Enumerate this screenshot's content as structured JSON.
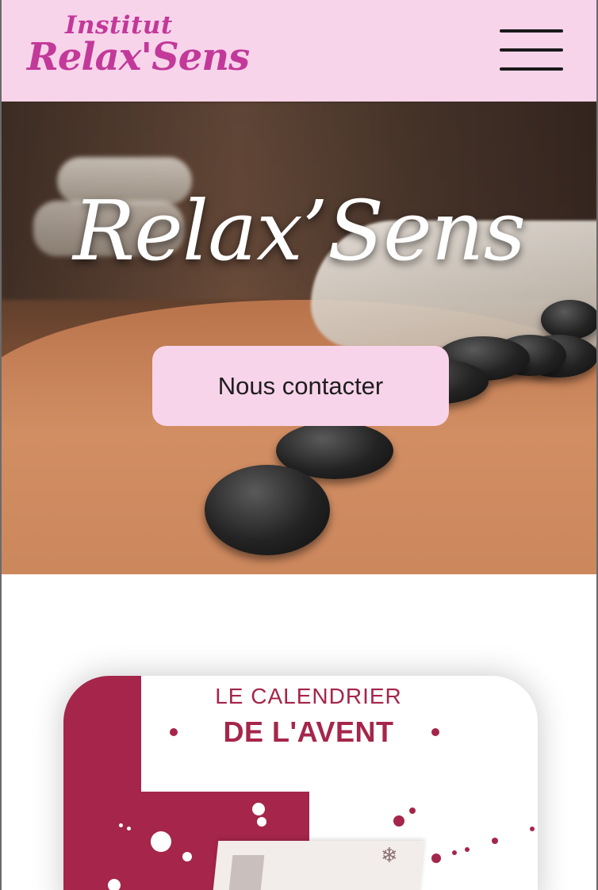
{
  "header": {
    "logo_top": "Institut",
    "logo_main": "Relax'Sens",
    "menu_icon": "hamburger-menu-icon"
  },
  "hero": {
    "title": "Relax’Sens",
    "cta_label": "Nous contacter"
  },
  "promo_card": {
    "kicker": "LE CALENDRIER",
    "headline": "DE L'AVENT"
  },
  "colors": {
    "header_bg": "#f8d4ea",
    "logo": "#c2399a",
    "card_accent": "#a5264a"
  }
}
